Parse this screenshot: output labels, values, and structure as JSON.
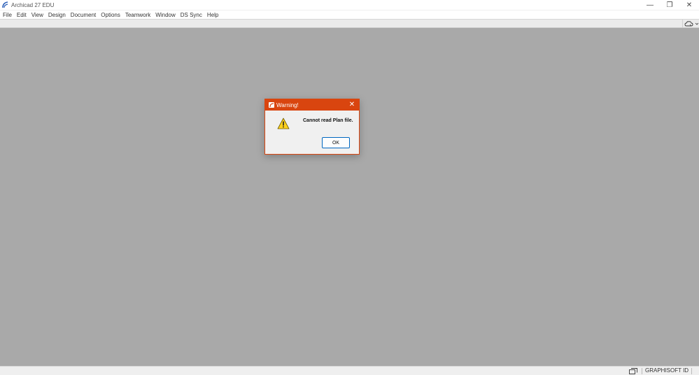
{
  "window": {
    "title": "Archicad 27 EDU",
    "controls": {
      "minimize": "—",
      "restore": "❐",
      "close": "✕"
    }
  },
  "menu": {
    "items": [
      {
        "label": "File"
      },
      {
        "label": "Edit"
      },
      {
        "label": "View"
      },
      {
        "label": "Design"
      },
      {
        "label": "Document"
      },
      {
        "label": "Options"
      },
      {
        "label": "Teamwork"
      },
      {
        "label": "Window"
      },
      {
        "label": "DS Sync"
      },
      {
        "label": "Help"
      }
    ]
  },
  "toolbar": {
    "tool_icon": "cloud-dropdown-icon"
  },
  "dialog": {
    "title": "Warning!",
    "message": "Cannot read Plan file.",
    "ok_label": "OK",
    "icon": "warning-icon",
    "accent": "#d9450f"
  },
  "status": {
    "id_label": "GRAPHISOFT ID"
  },
  "colors": {
    "workspace": "#a9a9a9",
    "dialog_header": "#d9450f",
    "warning_yellow": "#ffd21e",
    "ok_border": "#0067c0"
  }
}
